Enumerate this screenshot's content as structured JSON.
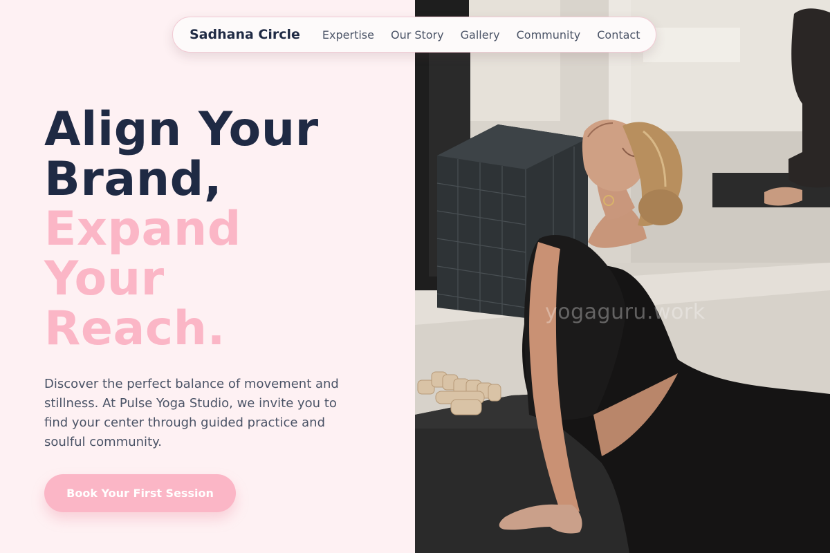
{
  "nav": {
    "brand": "Sadhana Circle",
    "links": [
      "Expertise",
      "Our Story",
      "Gallery",
      "Community",
      "Contact"
    ]
  },
  "hero": {
    "headline_dark": [
      "Align Your",
      "Brand,"
    ],
    "headline_pink": [
      "Expand",
      "Your",
      "Reach."
    ],
    "lead": "Discover the perfect balance of movement and stillness. At Pulse Yoga Studio, we invite you to find your center through guided practice and soulful community.",
    "cta_label": "Book Your First Session"
  },
  "photo": {
    "watermark": "yogaguru.work"
  },
  "colors": {
    "background": "#fef1f3",
    "heading_dark": "#1f2a44",
    "accent_pink": "#fbb6c6",
    "body_text": "#4a5366"
  }
}
